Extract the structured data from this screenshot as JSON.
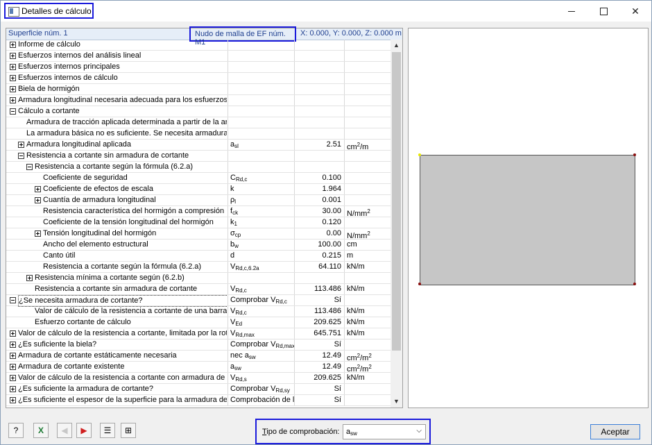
{
  "window": {
    "title": "Detalles de cálculo"
  },
  "header": {
    "surface": "Superficie núm. 1",
    "node": "Nudo de malla de EF núm. M1",
    "coords": "X: 0.000, Y: 0.000, Z: 0.000 m"
  },
  "rows": [
    {
      "label": "Informe de cálculo",
      "sym": "",
      "val": "",
      "unit": ""
    },
    {
      "label": "Esfuerzos internos del análisis lineal",
      "sym": "",
      "val": "",
      "unit": ""
    },
    {
      "label": "Esfuerzos internos principales",
      "sym": "",
      "val": "",
      "unit": ""
    },
    {
      "label": "Esfuerzos internos de cálculo",
      "sym": "",
      "val": "",
      "unit": ""
    },
    {
      "label": "Biela de hormigón",
      "sym": "",
      "val": "",
      "unit": ""
    },
    {
      "label": "Armadura longitudinal necesaria adecuada para los esfuerzos de membrana de cálculo",
      "sym": "",
      "val": "",
      "unit": ""
    },
    {
      "label": "Cálculo a cortante",
      "sym": "",
      "val": "",
      "unit": ""
    },
    {
      "label": "Armadura de tracción aplicada determinada a partir de la armadura longitudinal necesaria.",
      "sym": "",
      "val": "",
      "unit": ""
    },
    {
      "label": "La armadura básica no es suficiente. Se necesita armadura de cortante.",
      "sym": "",
      "val": "",
      "unit": ""
    },
    {
      "label": "Armadura longitudinal aplicada",
      "sym": "a",
      "sub": "sl",
      "val": "2.51",
      "unit": "cm",
      "usup": "2",
      "utail": "/m"
    },
    {
      "label": "Resistencia a cortante sin armadura de cortante",
      "sym": "",
      "val": "",
      "unit": ""
    },
    {
      "label": "Resistencia a cortante según la fórmula (6.2.a)",
      "sym": "",
      "val": "",
      "unit": ""
    },
    {
      "label": "Coeficiente de seguridad",
      "sym": "C",
      "sub": "Rd,c",
      "val": "0.100",
      "unit": ""
    },
    {
      "label": "Coeficiente de efectos de escala",
      "sym": "k",
      "val": "1.964",
      "unit": ""
    },
    {
      "label": "Cuantía de armadura longitudinal",
      "sym": "ρ",
      "sub": "l",
      "val": "0.001",
      "unit": ""
    },
    {
      "label": "Resistencia característica del hormigón a compresión",
      "sym": "f",
      "sub": "ck",
      "val": "30.00",
      "unit": "N/mm",
      "usup": "2"
    },
    {
      "label": "Coeficiente de la tensión longitudinal del hormigón",
      "sym": "k",
      "sub": "1",
      "val": "0.120",
      "unit": ""
    },
    {
      "label": "Tensión longitudinal del hormigón",
      "sym": "σ",
      "sub": "cp",
      "val": "0.00",
      "unit": "N/mm",
      "usup": "2"
    },
    {
      "label": "Ancho del elemento estructural",
      "sym": "b",
      "sub": "w",
      "val": "100.00",
      "unit": "cm"
    },
    {
      "label": "Canto útil",
      "sym": "d",
      "val": "0.215",
      "unit": "m"
    },
    {
      "label": "Resistencia a cortante según la fórmula (6.2.a)",
      "sym": "V",
      "sub": "Rd,c,6.2a",
      "val": "64.110",
      "unit": "kN/m"
    },
    {
      "label": "Resistencia mínima a cortante según (6.2.b)",
      "sym": "",
      "val": "",
      "unit": ""
    },
    {
      "label": "Resistencia a cortante sin armadura de cortante",
      "sym": "V",
      "sub": "Rd,c",
      "val": "113.486",
      "unit": "kN/m"
    },
    {
      "label": "¿Se necesita armadura de cortante?",
      "sym": "Comprobar V",
      "sub": "Rd,c",
      "val": "Sí",
      "unit": ""
    },
    {
      "label": "Valor de cálculo de la resistencia a cortante de una barra sin armadura",
      "sym": "V",
      "sub": "Rd,c",
      "val": "113.486",
      "unit": "kN/m"
    },
    {
      "label": "Esfuerzo cortante de cálculo",
      "sym": "V",
      "sub": "Ed",
      "val": "209.625",
      "unit": "kN/m"
    },
    {
      "label": "Valor de cálculo de la resistencia a cortante, limitada por la rotura",
      "sym": "V",
      "sub": "Rd,max",
      "val": "645.751",
      "unit": "kN/m"
    },
    {
      "label": "¿Es suficiente la biela?",
      "sym": "Comprobar V",
      "sub": "Rd,max",
      "val": "Sí",
      "unit": ""
    },
    {
      "label": "Armadura de cortante estáticamente necesaria",
      "sym": "nec a",
      "sub": "sw",
      "val": "12.49",
      "unit": "cm",
      "usup": "2",
      "utail": "/m",
      "usup2": "2"
    },
    {
      "label": "Armadura de cortante existente",
      "sym": "a",
      "sub": "sw",
      "val": "12.49",
      "unit": "cm",
      "usup": "2",
      "utail": "/m",
      "usup2": "2"
    },
    {
      "label": "Valor de cálculo de la resistencia a cortante con armadura de cortante",
      "sym": "V",
      "sub": "Rd,s",
      "val": "209.625",
      "unit": "kN/m"
    },
    {
      "label": "¿Es suficiente la armadura de cortante?",
      "sym": "Comprobar V",
      "sub": "Rd,sy",
      "val": "Sí",
      "unit": ""
    },
    {
      "label": "¿Es suficiente el espesor de la superficie para la armadura de cortante?",
      "sym": "Comprobación de l",
      "val": "Sí",
      "unit": ""
    }
  ],
  "bottom": {
    "check_label_u": "T",
    "check_label_rest": "ipo de comprobación:",
    "check_value": "a",
    "check_value_sub": "sw",
    "ok": "Aceptar"
  }
}
